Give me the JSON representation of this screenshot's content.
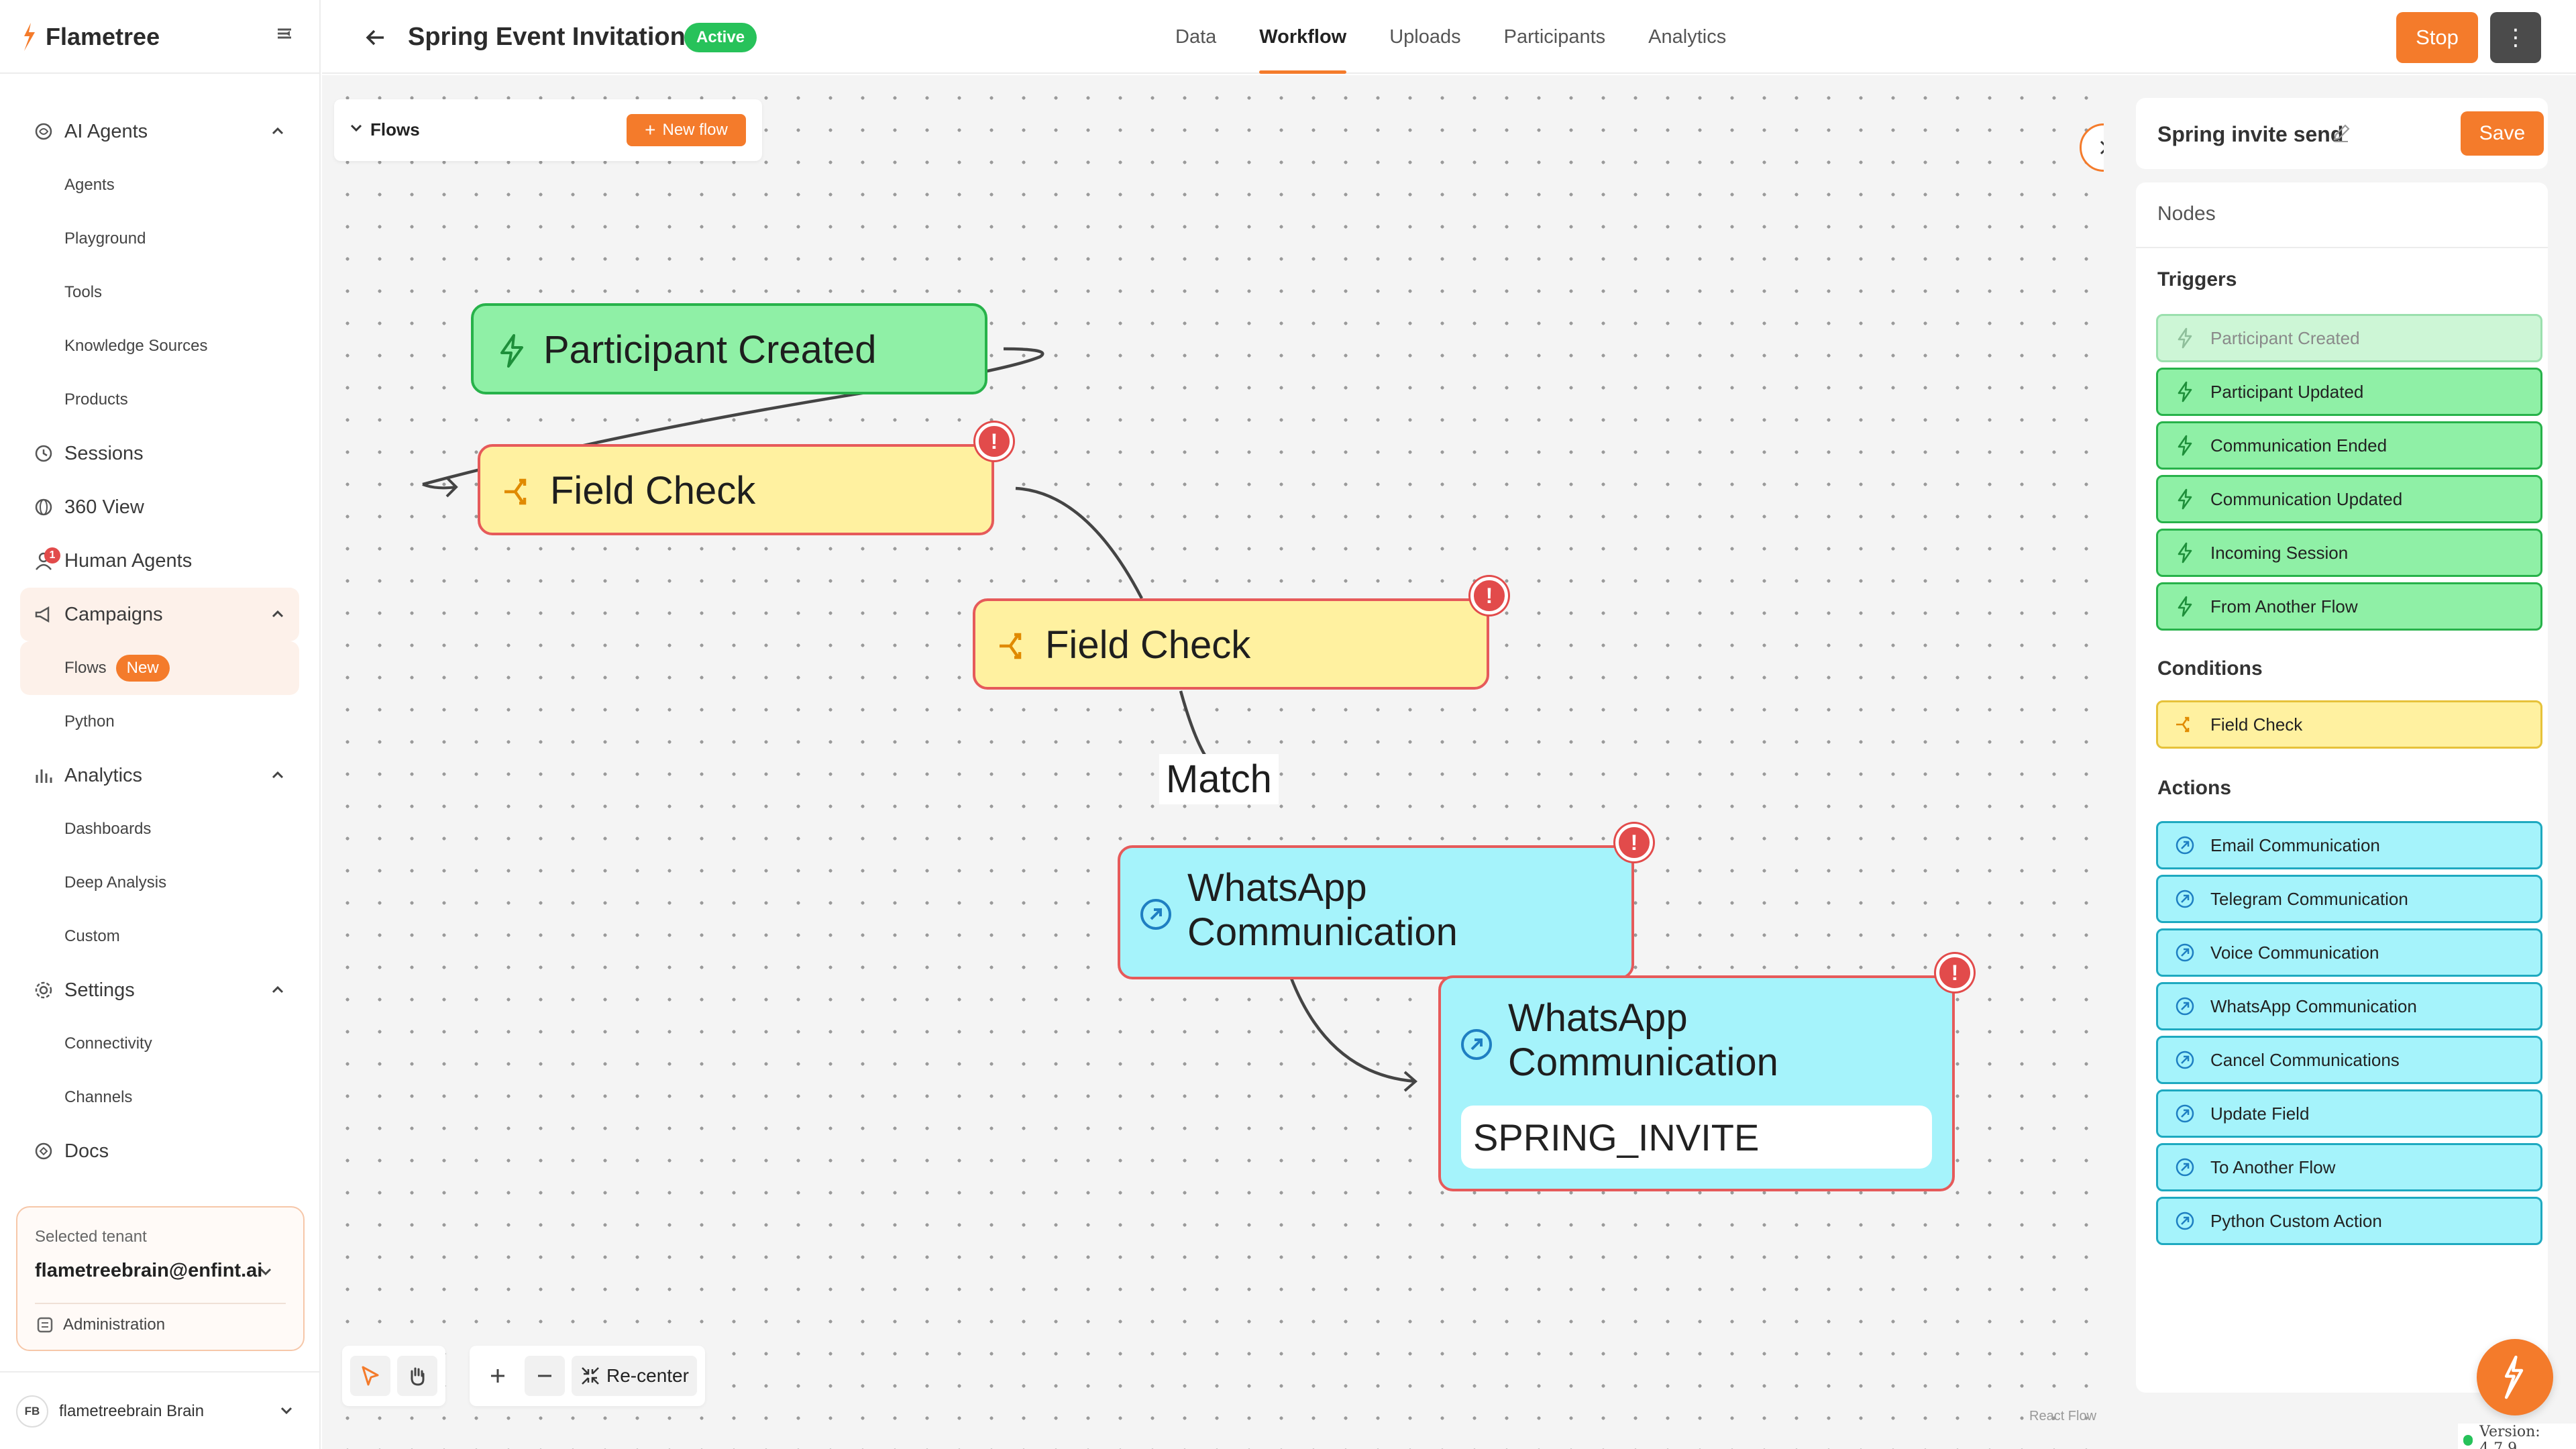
{
  "brand": {
    "name": "Flametree"
  },
  "colors": {
    "accent": "#f47b2b",
    "trigger": "#8ff0a6",
    "condition": "#fff1a0",
    "action": "#a5f3fb",
    "error": "#e24b4b",
    "active": "#27c25a"
  },
  "sidebar": {
    "groups": [
      {
        "label": "AI Agents",
        "icon": "sparkle-brain-icon",
        "items": [
          "Agents",
          "Playground",
          "Tools",
          "Knowledge Sources",
          "Products"
        ]
      },
      {
        "label": "Sessions",
        "icon": "history-icon"
      },
      {
        "label": "360 View",
        "icon": "globe-icon"
      },
      {
        "label": "Human Agents",
        "icon": "person-icon",
        "badge": "1"
      },
      {
        "label": "Campaigns",
        "icon": "megaphone-icon",
        "items": [
          "Flows",
          "Python"
        ],
        "active_item": "Flows",
        "flows_badge": "New"
      },
      {
        "label": "Analytics",
        "icon": "bar-chart-icon",
        "items": [
          "Dashboards",
          "Deep Analysis",
          "Custom"
        ]
      },
      {
        "label": "Settings",
        "icon": "gear-icon",
        "items": [
          "Connectivity",
          "Channels"
        ]
      },
      {
        "label": "Docs",
        "icon": "book-icon"
      }
    ],
    "tenant": {
      "label": "Selected tenant",
      "value": "flametreebrain@enfint.ai",
      "admin": "Administration"
    },
    "user": {
      "initials": "FB",
      "name": "flametreebrain Brain"
    }
  },
  "header": {
    "title": "Spring Event Invitations",
    "status": "Active",
    "tabs": [
      "Data",
      "Workflow",
      "Uploads",
      "Participants",
      "Analytics"
    ],
    "active_tab": "Workflow",
    "stop_label": "Stop",
    "more_label": "⋮"
  },
  "canvas": {
    "flows_title": "Flows",
    "new_flow_label": "New flow",
    "nodes": {
      "trigger": "Participant Created",
      "check1": "Field Check",
      "check2": "Field Check",
      "whatsapp1_line1": "WhatsApp",
      "whatsapp1_line2": "Communication",
      "whatsapp2_line1": "WhatsApp",
      "whatsapp2_line2": "Communication",
      "whatsapp2_template": "SPRING_INVITE"
    },
    "edge_label": "Match",
    "recenter_label": "Re-center",
    "attribution": "React Flow"
  },
  "panel": {
    "flow_name": "Spring invite send",
    "save_label": "Save",
    "nodes_title": "Nodes",
    "triggers_title": "Triggers",
    "triggers": [
      "Participant Created",
      "Participant Updated",
      "Communication Ended",
      "Communication Updated",
      "Incoming Session",
      "From Another Flow"
    ],
    "conditions_title": "Conditions",
    "conditions": [
      "Field Check"
    ],
    "actions_title": "Actions",
    "actions": [
      "Email Communication",
      "Telegram Communication",
      "Voice Communication",
      "WhatsApp Communication",
      "Cancel Communications",
      "Update Field",
      "To Another Flow",
      "Python Custom Action"
    ]
  },
  "version": "Version: 4.7.9"
}
